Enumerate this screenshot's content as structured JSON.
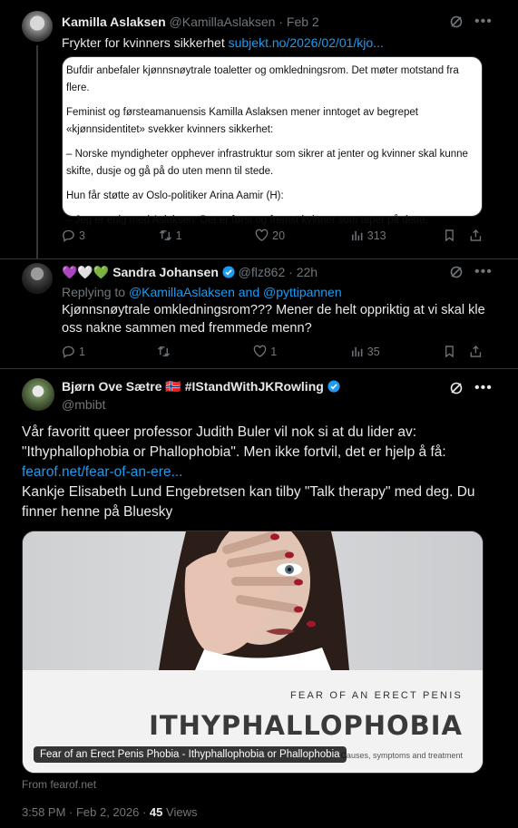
{
  "tweet1": {
    "name": "Kamilla Aslaksen",
    "handle": "@KamillaAslaksen",
    "separator": "·",
    "date": "Feb 2",
    "text_prefix": "Frykter for kvinners sikkerhet",
    "link": "subjekt.no/2026/02/01/kjo...",
    "quote_paragraphs": [
      "Bufdir anbefaler kjønnsnøytrale toaletter og omkledningsrom. Det møter motstand fra flere.",
      "Feminist og førsteamanuensis Kamilla Aslaksen mener inntoget av begrepet «kjønnsidentitet» svekker kvinners sikkerhet:",
      "– Norske myndigheter opphever infrastruktur som sikrer at jenter og kvinner skal kunne skifte, dusje og gå på do uten menn til stede.",
      "Hun får støtte av Oslo-politiker Arina Aamir (H):",
      "– Jeg er enig med Aslaksen: Det er først og fremst kvinner som taper på dette."
    ],
    "replies": "3",
    "retweets": "1",
    "likes": "20",
    "views": "313"
  },
  "tweet2": {
    "emoji_prefix": "💜🤍💚",
    "name": "Sandra Johansen",
    "handle": "@flz862",
    "separator": "·",
    "date": "22h",
    "replying_label": "Replying to",
    "replying_to": "@KamillaAslaksen and @pyttipannen",
    "text": "Kjønnsnøytrale omkledningsrom??? Mener de helt oppriktig at vi skal kle oss nakne sammen med fremmede menn?",
    "replies": "1",
    "retweets": "",
    "likes": "1",
    "views": "35"
  },
  "tweet3": {
    "name": "Bjørn Ove Sætre",
    "flag": "🇳🇴",
    "name_suffix": "#IStandWithJKRowling",
    "handle": "@mbibt",
    "text_line1": "Vår favoritt queer professor Judith Buler vil nok si at du lider av: \"Ithyphallophobia or Phallophobia\". Men ikke fortvil, det er hjelp å få:",
    "link": "fearof.net/fear-of-an-ere...",
    "text_line2": "Kankje Elisabeth Lund Engebretsen kan tilby \"Talk therapy\" med deg. Du finner henne på Bluesky",
    "card": {
      "kicker": "FEAR OF AN ERECT PENIS",
      "title": "ITHYPHALLOPHOBIA",
      "subtitle": "Causes, symptoms and treatment",
      "caption": "Fear of an Erect Penis Phobia - Ithyphallophobia or Phallophobia"
    },
    "from": "From fearof.net",
    "time": "3:58 PM · Feb 2, 2026 ·",
    "views_count": "45",
    "views_label": "Views"
  },
  "colors": {
    "background": "#000000",
    "text": "#e7e9ea",
    "muted": "#71767b",
    "link": "#1d9bf0",
    "verified": "#1d9bf0",
    "divider": "#2f3336"
  }
}
